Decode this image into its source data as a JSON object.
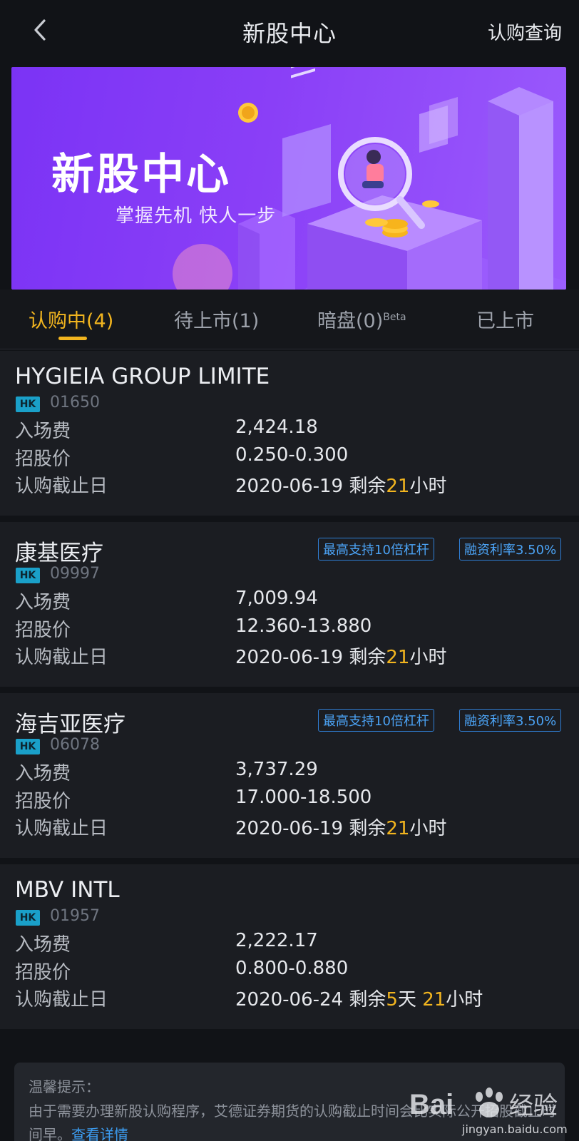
{
  "header": {
    "title": "新股中心",
    "right_action": "认购查询"
  },
  "banner": {
    "title": "新股中心",
    "subtitle": "掌握先机 快人一步"
  },
  "tabs": [
    {
      "label": "认购中(4)",
      "active": true
    },
    {
      "label": "待上市(1)",
      "active": false
    },
    {
      "label": "暗盘(0)",
      "superscript": "Beta",
      "active": false
    },
    {
      "label": "已上市",
      "active": false
    }
  ],
  "row_labels": {
    "fee": "入场费",
    "price": "招股价",
    "deadline": "认购截止日"
  },
  "ipos": [
    {
      "name": "HYGIEIA GROUP LIMITE",
      "market": "HK",
      "code": "01650",
      "fee": "2,424.18",
      "price": "0.250-0.300",
      "deadline_date": "2020-06-19",
      "remain_prefix": "剩余",
      "remain_days": "",
      "remain_days_unit": "",
      "remain_hours": "21",
      "remain_hours_unit": "小时",
      "tags": []
    },
    {
      "name": "康基医疗",
      "market": "HK",
      "code": "09997",
      "fee": "7,009.94",
      "price": "12.360-13.880",
      "deadline_date": "2020-06-19",
      "remain_prefix": "剩余",
      "remain_days": "",
      "remain_days_unit": "",
      "remain_hours": "21",
      "remain_hours_unit": "小时",
      "tags": [
        "最高支持10倍杠杆",
        "融资利率3.50%"
      ]
    },
    {
      "name": "海吉亚医疗",
      "market": "HK",
      "code": "06078",
      "fee": "3,737.29",
      "price": "17.000-18.500",
      "deadline_date": "2020-06-19",
      "remain_prefix": "剩余",
      "remain_days": "",
      "remain_days_unit": "",
      "remain_hours": "21",
      "remain_hours_unit": "小时",
      "tags": [
        "最高支持10倍杠杆",
        "融资利率3.50%"
      ]
    },
    {
      "name": "MBV INTL",
      "market": "HK",
      "code": "01957",
      "fee": "2,222.17",
      "price": "0.800-0.880",
      "deadline_date": "2020-06-24",
      "remain_prefix": "剩余",
      "remain_days": "5",
      "remain_days_unit": "天 ",
      "remain_hours": "21",
      "remain_hours_unit": "小时",
      "tags": []
    }
  ],
  "tip": {
    "title": "温馨提示：",
    "body": "由于需要办理新股认购程序，艾德证券期货的认购截止时间会比实际公开招股截止时间早。",
    "link": "查看详情"
  },
  "watermark": {
    "brand": "Bai度经验",
    "url": "jingyan.baidu.com"
  },
  "colors": {
    "background": "#111317",
    "card": "#1b1d22",
    "accent": "#f2b51f",
    "tag_blue": "#4ba3f5",
    "badge": "#1aa0c9",
    "banner": "#8a3ff7"
  }
}
